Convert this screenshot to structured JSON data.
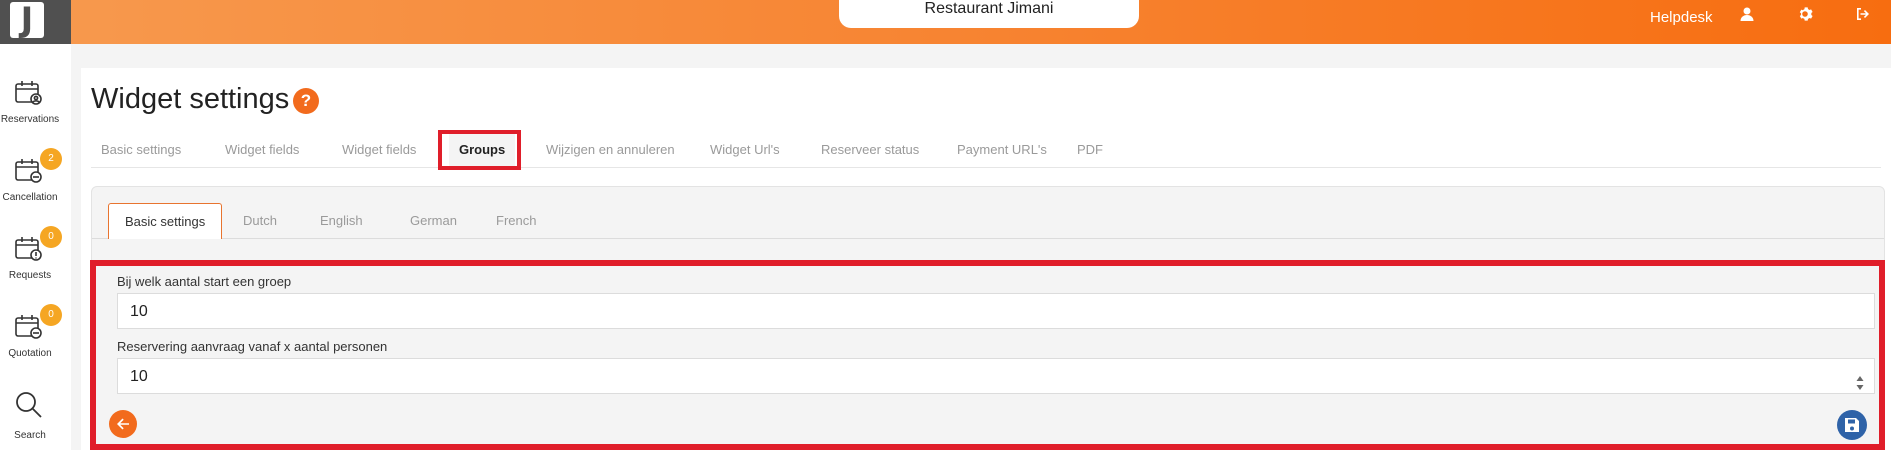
{
  "app": {
    "logo_letter": "J",
    "restaurant_name": "Restaurant Jimani",
    "helpdesk_label": "Helpdesk"
  },
  "header": {
    "icons": [
      "user-icon",
      "gear-icon",
      "logout-icon"
    ]
  },
  "sidebar": {
    "items": [
      {
        "label": "Reservations",
        "icon": "calendar-user-icon",
        "badge": ""
      },
      {
        "label": "Cancellation",
        "icon": "calendar-minus-icon",
        "badge": "2"
      },
      {
        "label": "Requests",
        "icon": "calendar-alert-icon",
        "badge": "0"
      },
      {
        "label": "Quotation",
        "icon": "calendar-minus-icon",
        "badge": "0"
      },
      {
        "label": "Search",
        "icon": "search-icon",
        "badge": ""
      }
    ]
  },
  "page": {
    "title": "Widget settings",
    "help_symbol": "?"
  },
  "tabs": [
    {
      "label": "Basic settings"
    },
    {
      "label": "Widget fields"
    },
    {
      "label": "Widget fields"
    },
    {
      "label": "Groups",
      "active": true
    },
    {
      "label": "Wijzigen en annuleren"
    },
    {
      "label": "Widget Url's"
    },
    {
      "label": "Reserveer status"
    },
    {
      "label": "Payment URL's"
    },
    {
      "label": "PDF"
    }
  ],
  "subtabs": [
    {
      "label": "Basic settings",
      "active": true
    },
    {
      "label": "Dutch"
    },
    {
      "label": "English"
    },
    {
      "label": "German"
    },
    {
      "label": "French"
    }
  ],
  "form": {
    "group_start_label": "Bij welk aantal start een groep",
    "group_start_value": "10",
    "request_from_label": "Reservering aanvraag vanaf x aantal personen",
    "request_from_value": "10"
  },
  "colors": {
    "accent": "#f26b1d",
    "highlight": "#e01e2a",
    "save": "#2f63a8",
    "badge": "#f5a623"
  }
}
